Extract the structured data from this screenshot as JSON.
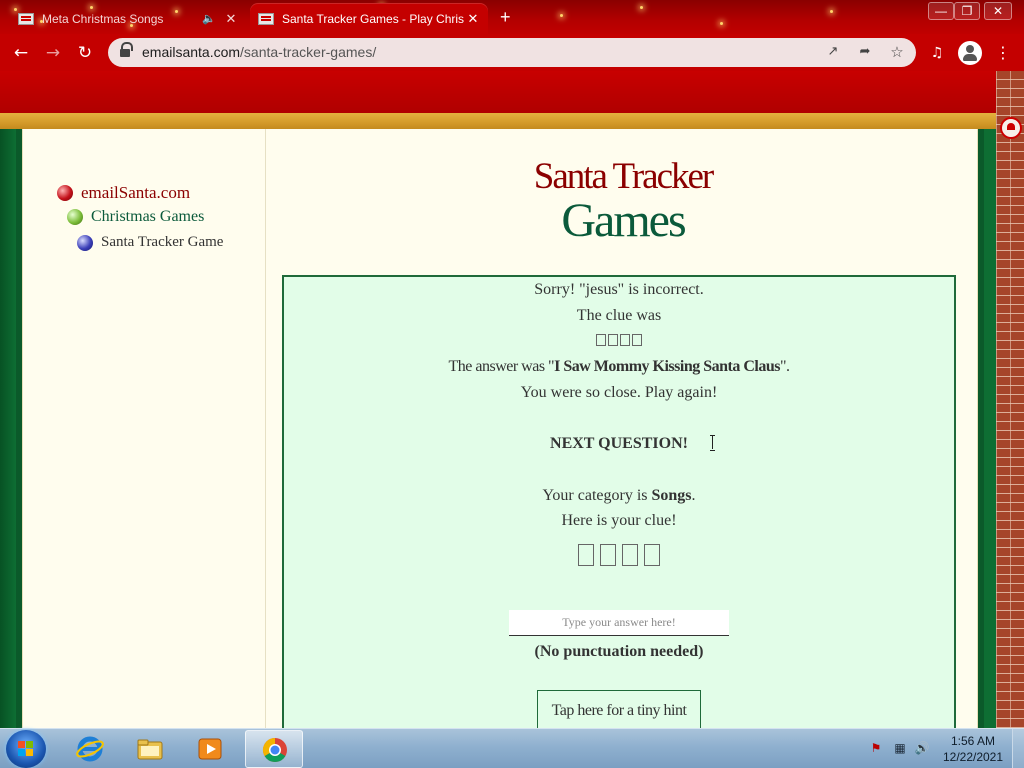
{
  "browser": {
    "tabs": [
      {
        "title": "Meta Christmas Songs",
        "active": false
      },
      {
        "title": "Santa Tracker Games - Play Chris",
        "active": true
      }
    ],
    "new_tab": "+",
    "url": {
      "domain": "emailsanta.com",
      "path": "/santa-tracker-games/"
    }
  },
  "icons": {
    "back": "back-arrow-icon",
    "forward": "forward-arrow-icon",
    "reload": "reload-icon",
    "lock": "lock-icon",
    "open_in_app": "open-in-app-icon",
    "share": "share-icon",
    "bookmark": "star-icon",
    "media": "media-control-icon",
    "profile": "profile-icon",
    "menu": "kebab-menu-icon"
  },
  "colors": {
    "chrome_red": "#c40000",
    "title_red": "#8b0000",
    "title_green": "#0b5a3b",
    "game_bg": "#e2fde8",
    "page_bg": "#fffdee"
  },
  "sidebar": {
    "items": [
      {
        "label": "emailSanta.com",
        "ornament": "red"
      },
      {
        "label": "Christmas Games",
        "ornament": "green"
      },
      {
        "label": "Santa Tracker Game",
        "ornament": "blue"
      }
    ]
  },
  "header": {
    "title_line1": "Santa Tracker",
    "title_line2": "Games"
  },
  "game": {
    "result_sorry": "Sorry!  \"jesus\" is incorrect.",
    "clue_was_label": "The clue was",
    "prev_clue_glyph_count": 4,
    "answer_prefix": "The answer was \"",
    "answer": "I Saw Mommy Kissing Santa Claus",
    "answer_suffix": "\".",
    "so_close": "You were so close. Play again!",
    "next_question": "NEXT QUESTION!",
    "category_prefix": "Your category is ",
    "category": "Songs",
    "category_suffix": ".",
    "clue_label": "Here is your clue!",
    "clue_glyph_count": 4,
    "answer_placeholder": "Type your answer here!",
    "no_punctuation": "(No punctuation needed)",
    "hint_button": "Tap here for a tiny hint"
  },
  "taskbar": {
    "apps": [
      "start-button",
      "internet-explorer",
      "file-explorer",
      "media-player",
      "chrome"
    ],
    "time": "1:56 AM",
    "date": "12/22/2021"
  }
}
